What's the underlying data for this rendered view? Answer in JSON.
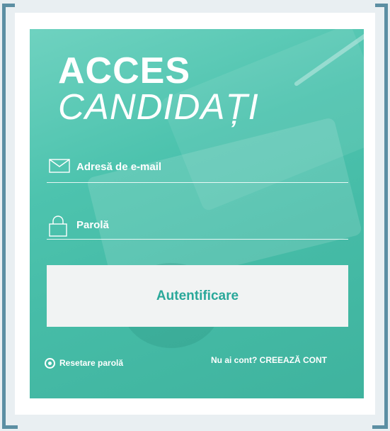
{
  "login": {
    "title_line1": "ACCES",
    "title_line2": "CANDIDAȚI",
    "email_placeholder": "Adresă de e-mail",
    "password_placeholder": "Parolă",
    "submit_label": "Autentificare",
    "reset_label": "Resetare parolă",
    "signup_label": "Nu ai cont? CREEAZĂ CONT",
    "icons": {
      "email": "envelope-icon",
      "password": "lock-icon",
      "reset": "radio-dot-icon"
    }
  },
  "colors": {
    "panel": "#46bca7",
    "button_text": "#2aa89a",
    "frame": "#5c8fa3"
  }
}
